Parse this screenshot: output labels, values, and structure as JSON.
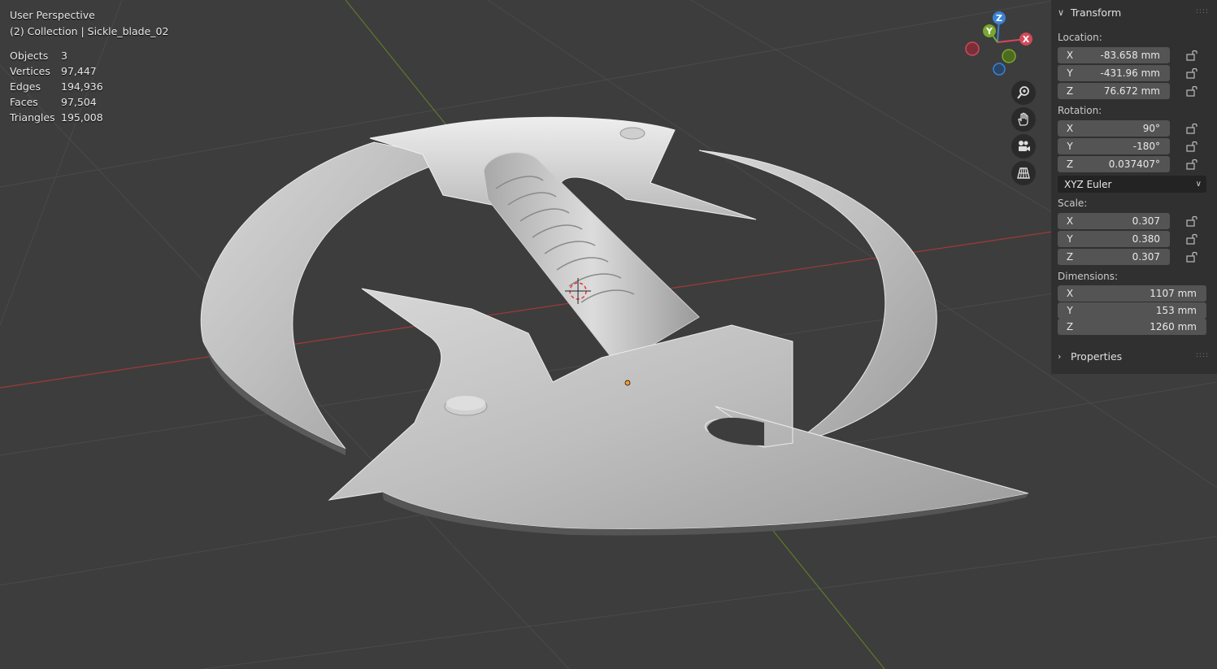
{
  "viewport": {
    "view_name": "User Perspective",
    "collection_line": "(2) Collection | Sickle_blade_02",
    "stats": [
      {
        "label": "Objects",
        "value": "3"
      },
      {
        "label": "Vertices",
        "value": "97,447"
      },
      {
        "label": "Edges",
        "value": "194,936"
      },
      {
        "label": "Faces",
        "value": "97,504"
      },
      {
        "label": "Triangles",
        "value": "195,008"
      }
    ],
    "gizmo": {
      "x_label": "X",
      "y_label": "Y",
      "z_label": "Z"
    },
    "nav_buttons": [
      "zoom-icon",
      "hand-pan-icon",
      "camera-icon",
      "grid-perspective-icon"
    ]
  },
  "colors": {
    "x_axis": "#d24a5a",
    "y_axis": "#79a82e",
    "z_axis": "#3a82d6",
    "panel_bg": "#303030",
    "field_bg": "#545454"
  },
  "panel": {
    "transform_title": "Transform",
    "location_label": "Location:",
    "location": [
      {
        "axis": "X",
        "value": "-83.658 mm"
      },
      {
        "axis": "Y",
        "value": "-431.96 mm"
      },
      {
        "axis": "Z",
        "value": "76.672 mm"
      }
    ],
    "rotation_label": "Rotation:",
    "rotation": [
      {
        "axis": "X",
        "value": "90°"
      },
      {
        "axis": "Y",
        "value": "-180°"
      },
      {
        "axis": "Z",
        "value": "0.037407°"
      }
    ],
    "rotation_mode": "XYZ Euler",
    "scale_label": "Scale:",
    "scale": [
      {
        "axis": "X",
        "value": "0.307"
      },
      {
        "axis": "Y",
        "value": "0.380"
      },
      {
        "axis": "Z",
        "value": "0.307"
      }
    ],
    "dimensions_label": "Dimensions:",
    "dimensions": [
      {
        "axis": "X",
        "value": "1107 mm"
      },
      {
        "axis": "Y",
        "value": "153 mm"
      },
      {
        "axis": "Z",
        "value": "1260 mm"
      }
    ],
    "properties_title": "Properties"
  }
}
